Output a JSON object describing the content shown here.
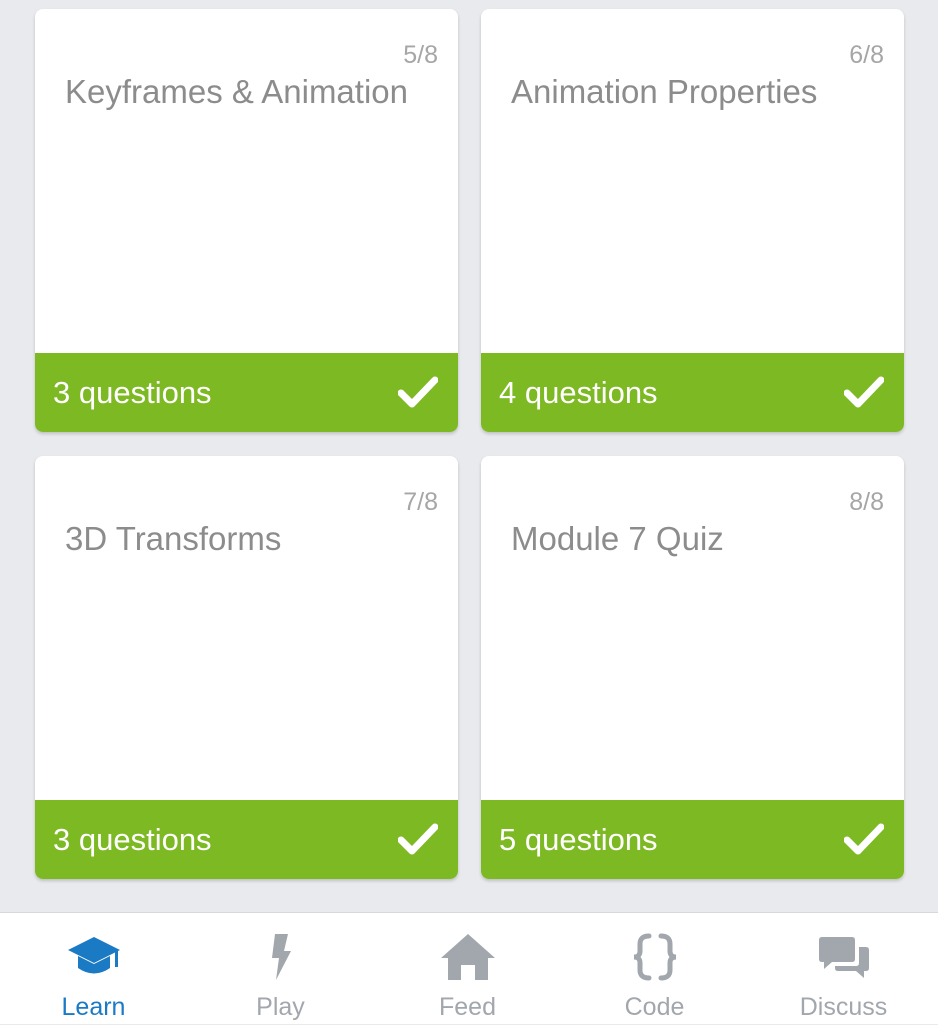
{
  "colors": {
    "background": "#e8eaed",
    "card": "#ffffff",
    "completed_green": "#7db923",
    "title_gray": "#8c8c8c",
    "counter_gray": "#a6a6a6",
    "tab_inactive": "#a2a7ad",
    "tab_active": "#1a7ac4"
  },
  "lessons": [
    {
      "counter": "5/8",
      "title": "Keyframes & Animation",
      "questions": "3 questions",
      "completed_icon": "checkmark-icon"
    },
    {
      "counter": "6/8",
      "title": "Animation Properties",
      "questions": "4 questions",
      "completed_icon": "checkmark-icon"
    },
    {
      "counter": "7/8",
      "title": "3D Transforms",
      "questions": "3 questions",
      "completed_icon": "checkmark-icon"
    },
    {
      "counter": "8/8",
      "title": "Module 7 Quiz",
      "questions": "5 questions",
      "completed_icon": "checkmark-icon"
    }
  ],
  "tabbar": {
    "active": "Learn",
    "items": [
      {
        "label": "Learn",
        "icon": "graduation-cap-icon"
      },
      {
        "label": "Play",
        "icon": "lightning-bolt-icon"
      },
      {
        "label": "Feed",
        "icon": "home-icon"
      },
      {
        "label": "Code",
        "icon": "curly-braces-icon"
      },
      {
        "label": "Discuss",
        "icon": "chat-bubbles-icon"
      }
    ]
  }
}
